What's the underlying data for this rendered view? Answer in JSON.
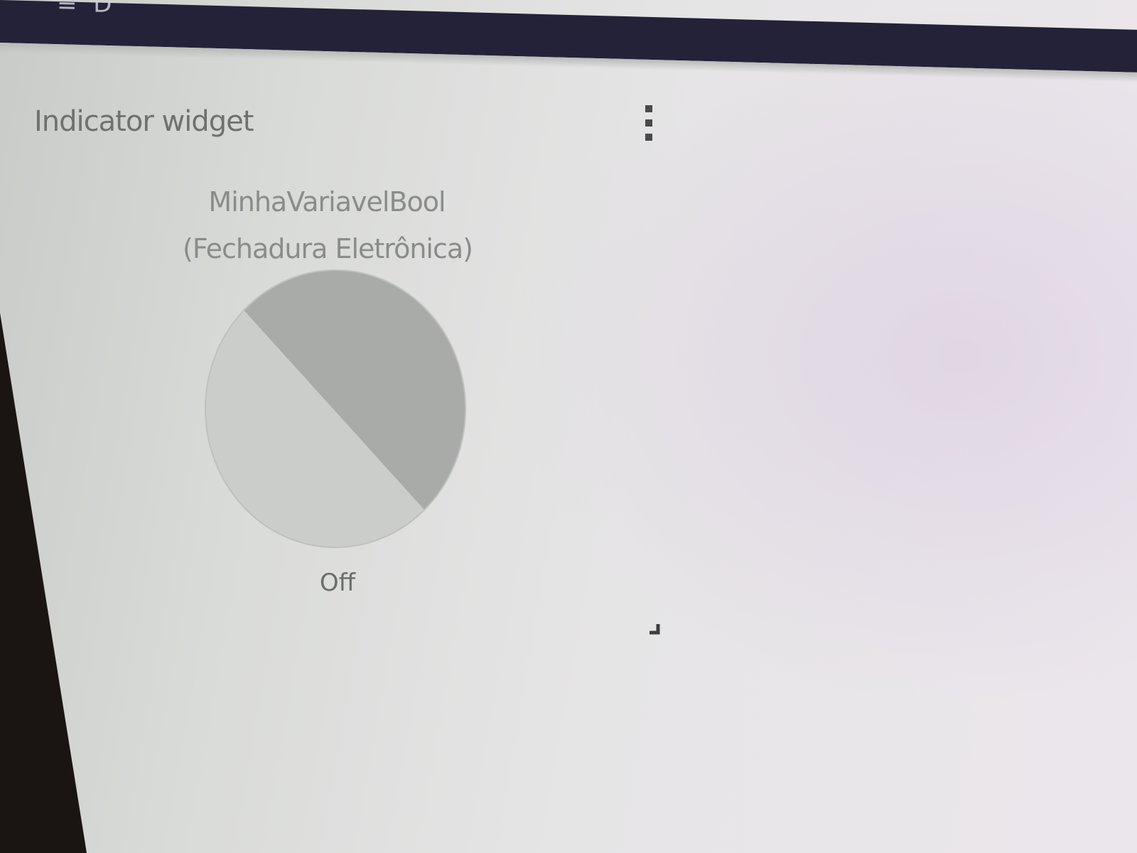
{
  "widget": {
    "title": "Indicator widget",
    "variable_name": "MinhaVariavelBool",
    "device_name": "(Fechadura Eletrônica)",
    "state_label": "Off",
    "state_value": false,
    "menu_icon": "more-vertical-icon",
    "resize_icon": "resize-handle-icon"
  },
  "colors": {
    "top_bar": "#242238",
    "lamp_light_half": "#cbcdca",
    "lamp_dark_half": "#a9aba8",
    "text_muted": "#8a8c8b"
  }
}
